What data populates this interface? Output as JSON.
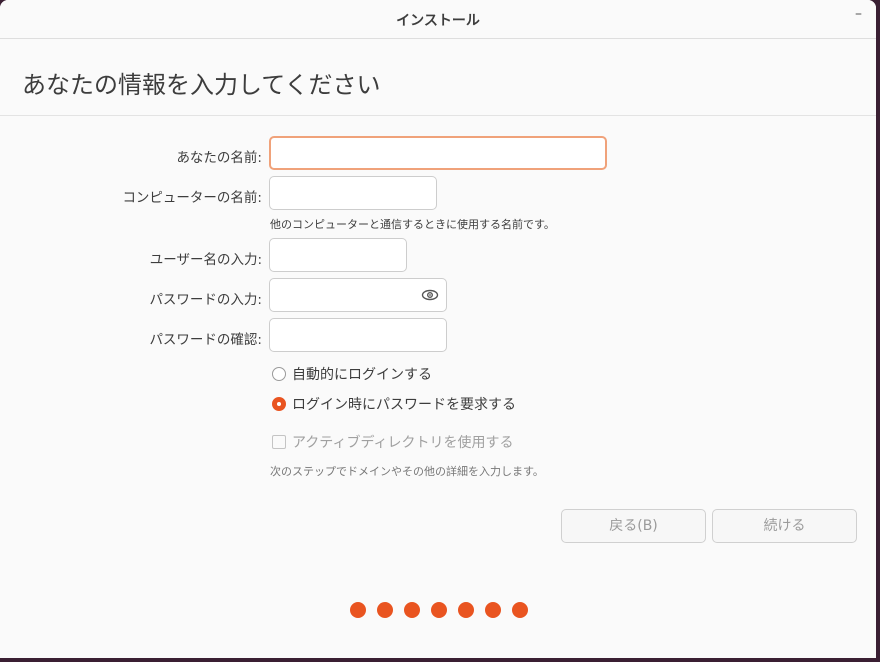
{
  "window": {
    "title": "インストール",
    "minimize_glyph": "–"
  },
  "page": {
    "heading": "あなたの情報を入力してください"
  },
  "form": {
    "name_label": "あなたの名前:",
    "name_value": "",
    "computer_label": "コンピューターの名前:",
    "computer_value": "",
    "computer_hint": "他のコンピューターと通信するときに使用する名前です。",
    "username_label": "ユーザー名の入力:",
    "username_value": "",
    "password_label": "パスワードの入力:",
    "password_value": "",
    "confirm_label": "パスワードの確認:",
    "confirm_value": "",
    "auto_login_label": "自動的にログインする",
    "require_password_label": "ログイン時にパスワードを要求する",
    "selected_login_option": "require_password",
    "ad_label": "アクティブディレクトリを使用する",
    "ad_checked": false,
    "ad_hint": "次のステップでドメインやその他の詳細を入力します。"
  },
  "buttons": {
    "back": "戻る(B)",
    "continue": "続ける"
  },
  "progress": {
    "step_dots": 7
  },
  "colors": {
    "accent": "#e95420",
    "focus_border": "#f0a27a"
  },
  "icons": {
    "password_toggle": "eye-icon"
  }
}
